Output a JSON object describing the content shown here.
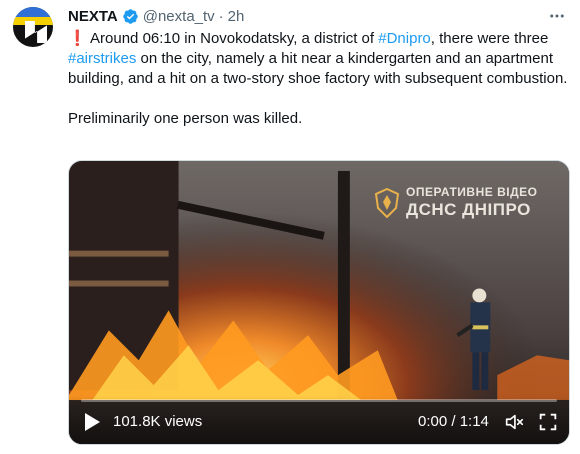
{
  "author": {
    "name": "NEXTA",
    "handle": "@nexta_tv",
    "separator": "·",
    "time": "2h"
  },
  "tweet": {
    "line1_pre": " Around 06:10 in Novokodatsky, a district of ",
    "hashtag_city": "#Dnipro",
    "line1_post": ", there were three ",
    "hashtag_strikes": "#airstrikes",
    "line2": " on the city, namely a hit near a kindergarten and an apartment building, and a hit on a two-story shoe factory with subsequent combustion.",
    "paragraph2": "Preliminarily one person was killed.",
    "alert_glyph": "❗"
  },
  "video": {
    "watermark_line1": "ОПЕРАТИВНЕ ВІДЕО",
    "watermark_line2": "ДСНС ДНІПРО",
    "views": "101.8K views",
    "time": "0:00 / 1:14",
    "progress": 0.0
  },
  "colors": {
    "link": "#1d9bf0",
    "verified": "#1d9bf0",
    "alert": "#d9303e",
    "secondary_text": "#536471"
  },
  "icons": {
    "verified": "verified-badge-icon",
    "more": "more-options-icon",
    "play": "play-icon",
    "volume": "volume-icon",
    "fullscreen": "fullscreen-icon"
  }
}
